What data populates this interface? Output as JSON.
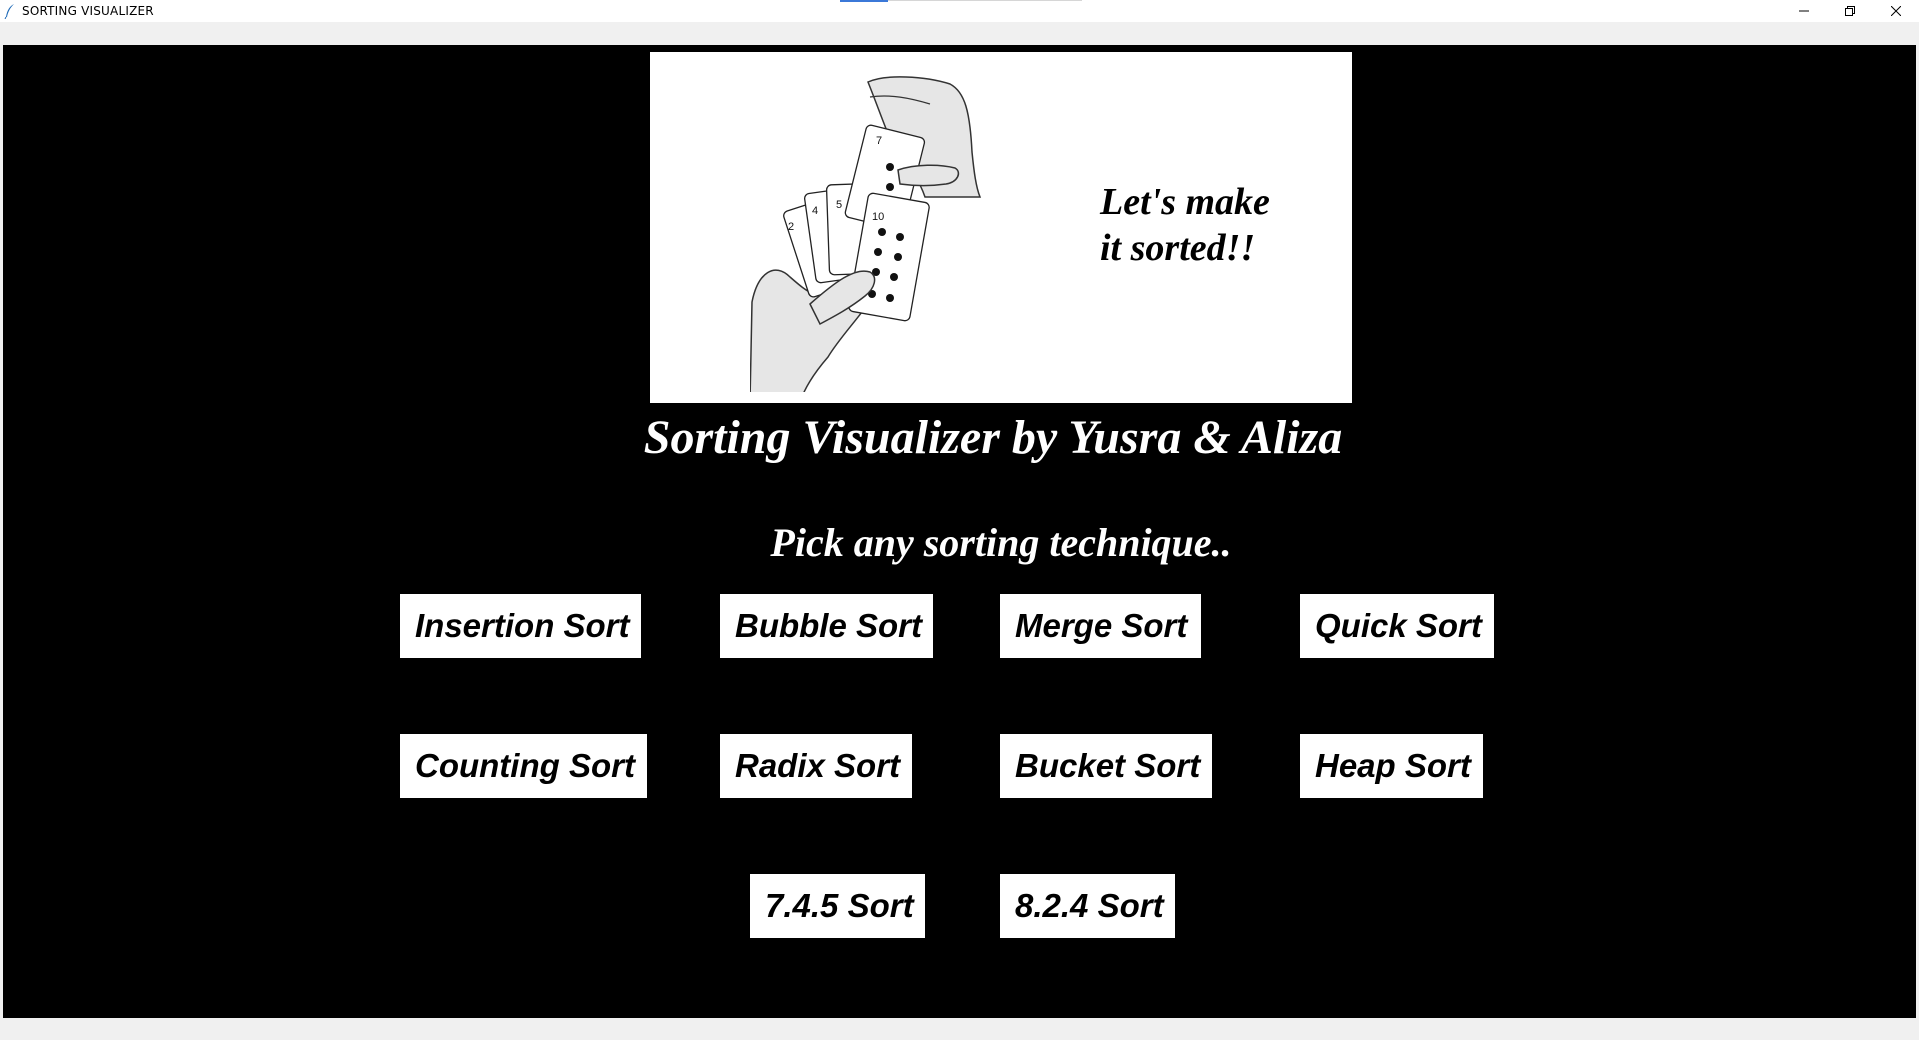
{
  "window": {
    "title": "SORTING VISUALIZER",
    "app_icon": "feather-icon",
    "controls": [
      "minimize-icon",
      "restore-icon",
      "close-icon"
    ]
  },
  "banner": {
    "tagline": "Let's make\nit sorted!!",
    "illustration": "hands-holding-playing-cards-image"
  },
  "header": {
    "title": "Sorting Visualizer by Yusra & Aliza",
    "subtitle": "Pick any sorting technique.."
  },
  "buttons": {
    "insertion": "Insertion Sort",
    "bubble": "Bubble Sort",
    "merge": "Merge Sort",
    "quick": "Quick Sort",
    "counting": "Counting Sort",
    "radix": "Radix Sort",
    "bucket": "Bucket Sort",
    "heap": "Heap Sort",
    "s745": "7.4.5 Sort",
    "s824": "8.2.4 Sort"
  },
  "colors": {
    "background": "#000000",
    "text": "#ffffff",
    "button_bg": "#ffffff",
    "button_text": "#000000"
  }
}
